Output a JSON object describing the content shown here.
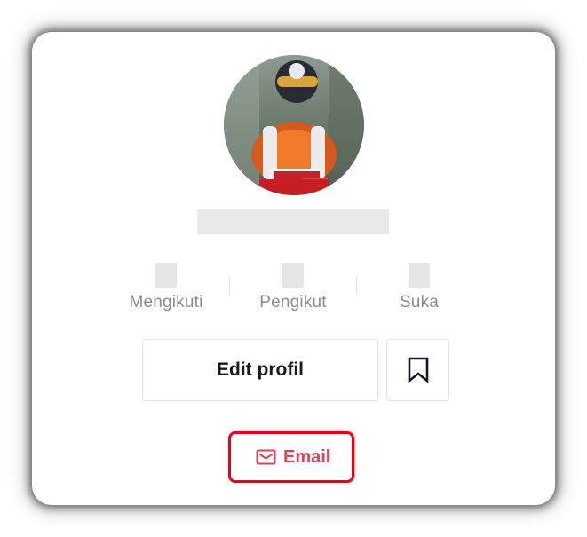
{
  "profile": {
    "stats": [
      {
        "label": "Mengikuti"
      },
      {
        "label": "Pengikut"
      },
      {
        "label": "Suka"
      }
    ],
    "edit_label": "Edit profil",
    "email_label": "Email"
  },
  "icons": {
    "bookmark": "bookmark-icon",
    "email": "envelope-icon"
  },
  "colors": {
    "email_accent": "#d9455b",
    "highlight": "#e8001c",
    "text_primary": "#161823",
    "text_secondary": "#8a8b91"
  }
}
